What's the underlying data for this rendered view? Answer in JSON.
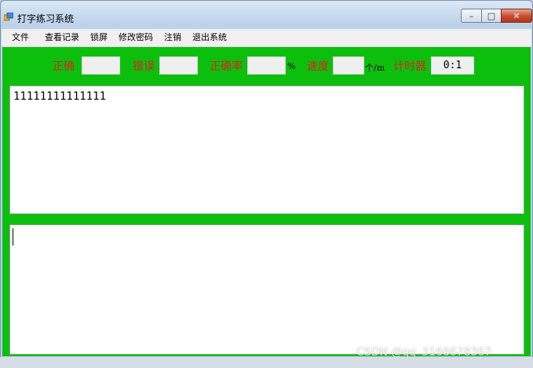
{
  "window": {
    "title": "打字练习系统",
    "icon": "app-window-icon",
    "controls": {
      "minimize": "–",
      "maximize": "□",
      "close": "✕"
    }
  },
  "menu": {
    "items": [
      "文件",
      "查看记录",
      "锁屏",
      "修改密码",
      "注销",
      "退出系统"
    ]
  },
  "stats": {
    "correct_label": "正确",
    "correct_value": "",
    "error_label": "错误",
    "error_value": "",
    "accuracy_label": "正确率",
    "accuracy_value": "",
    "accuracy_unit": "%",
    "speed_label": "速度",
    "speed_value": "",
    "speed_unit": "个/m",
    "timer_label": "计时器",
    "timer_value": "0:1"
  },
  "source_text": "11111111111111",
  "input_text": "",
  "watermark": "CSDN @qq_3166678367",
  "colors": {
    "client_bg": "#0dbf0d",
    "label_red": "#d92323"
  }
}
